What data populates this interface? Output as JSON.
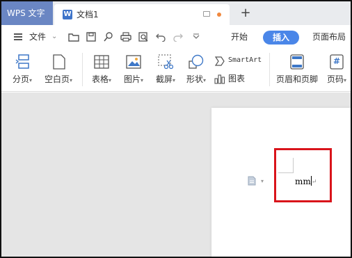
{
  "title_bar": {
    "app_tab_label": "WPS 文字",
    "doc_tab_icon_letter": "W",
    "doc_tab_title": "文档1",
    "new_tab_label": "+"
  },
  "menu": {
    "file_label": "文件",
    "file_chevron": "⌄",
    "tabs": [
      {
        "label": "开始"
      },
      {
        "label": "插入",
        "active": true
      },
      {
        "label": "页面布局"
      }
    ]
  },
  "ribbon": {
    "items": [
      {
        "label": "分页",
        "icon": "page-break-icon",
        "has_dropdown": true
      },
      {
        "label": "空白页",
        "icon": "blank-page-icon",
        "has_dropdown": true
      },
      {
        "label": "表格",
        "icon": "table-icon",
        "has_dropdown": true
      },
      {
        "label": "图片",
        "icon": "picture-icon",
        "has_dropdown": true
      },
      {
        "label": "截屏",
        "icon": "screenshot-icon",
        "has_dropdown": true
      },
      {
        "label": "形状",
        "icon": "shape-icon",
        "has_dropdown": true
      },
      {
        "label": "SmartArt",
        "icon": "smartart-icon",
        "has_dropdown": false
      },
      {
        "label": "图表",
        "icon": "chart-icon",
        "has_dropdown": false
      },
      {
        "label": "页眉和页脚",
        "icon": "header-footer-icon",
        "has_dropdown": false
      },
      {
        "label": "页码",
        "icon": "page-number-icon",
        "has_dropdown": true
      }
    ],
    "caret": "▾",
    "page_number_glyph": "#"
  },
  "document": {
    "text": "mm",
    "paragraph_mark": "↵"
  },
  "colors": {
    "app_tab_bg": "#6a86c3",
    "accent": "#4a86e8",
    "highlight_box": "#d9141b",
    "canvas_bg": "#e5e5e5"
  }
}
